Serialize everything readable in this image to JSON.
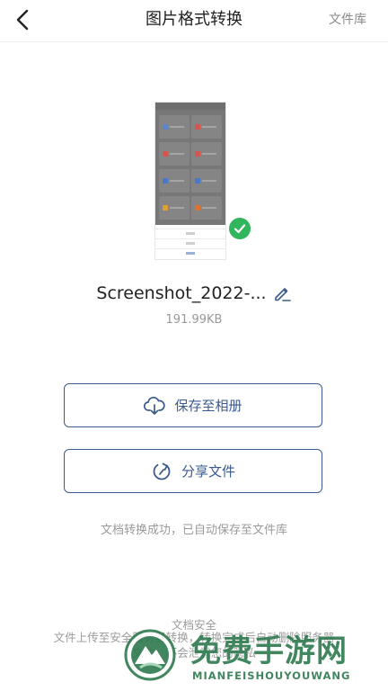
{
  "header": {
    "title": "图片格式转换",
    "file_library_label": "文件库",
    "back_icon": "chevron-left-icon"
  },
  "file": {
    "name": "Screenshot_2022-...",
    "size": "191.99KB",
    "converted": true
  },
  "actions": {
    "save_label": "保存至相册",
    "save_icon": "cloud-download-icon",
    "share_label": "分享文件",
    "share_icon": "refresh-share-icon"
  },
  "status_message": "文档转换成功，已自动保存至文件库",
  "security": {
    "title": "文档安全",
    "description": "文件上传至安全服务器转换，转换完成后自动删除服务器文件，不会泄露您的隐私"
  },
  "watermark": {
    "title": "免费手游网",
    "subtitle": "MIANFEISHOUYOUWANG"
  },
  "colors": {
    "accent": "#3b5a8d",
    "success": "#31b55d",
    "muted_text": "#9a9a9a",
    "watermark_green": "#2e7a4f"
  }
}
